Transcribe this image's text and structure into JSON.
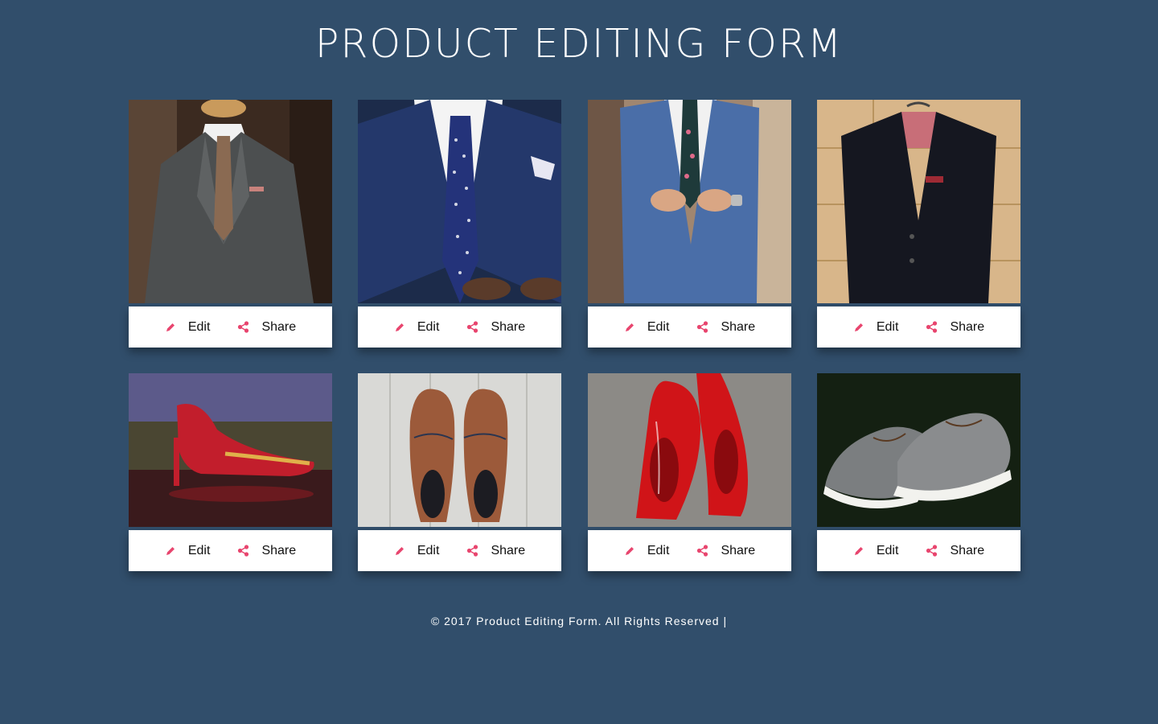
{
  "header": {
    "title": "PRODUCT EDITING FORM"
  },
  "products": [
    {
      "image": "grey-suit-on-mannequin",
      "edit_label": "Edit",
      "share_label": "Share"
    },
    {
      "image": "navy-suit-with-polka-dot-tie",
      "edit_label": "Edit",
      "share_label": "Share"
    },
    {
      "image": "blue-suit-floral-tie",
      "edit_label": "Edit",
      "share_label": "Share"
    },
    {
      "image": "black-blazer-on-hanger",
      "edit_label": "Edit",
      "share_label": "Share"
    },
    {
      "image": "red-embroidered-heel",
      "edit_label": "Edit",
      "share_label": "Share"
    },
    {
      "image": "brown-leather-oxfords",
      "edit_label": "Edit",
      "share_label": "Share"
    },
    {
      "image": "red-patent-heels",
      "edit_label": "Edit",
      "share_label": "Share"
    },
    {
      "image": "grey-canvas-sneakers",
      "edit_label": "Edit",
      "share_label": "Share"
    }
  ],
  "icons": {
    "edit": "pencil-icon",
    "share": "share-icon"
  },
  "colors": {
    "background": "#314e6b",
    "accent": "#e8456e",
    "card": "#ffffff"
  },
  "footer": {
    "text": "© 2017 Product Editing Form. All Rights Reserved |"
  }
}
